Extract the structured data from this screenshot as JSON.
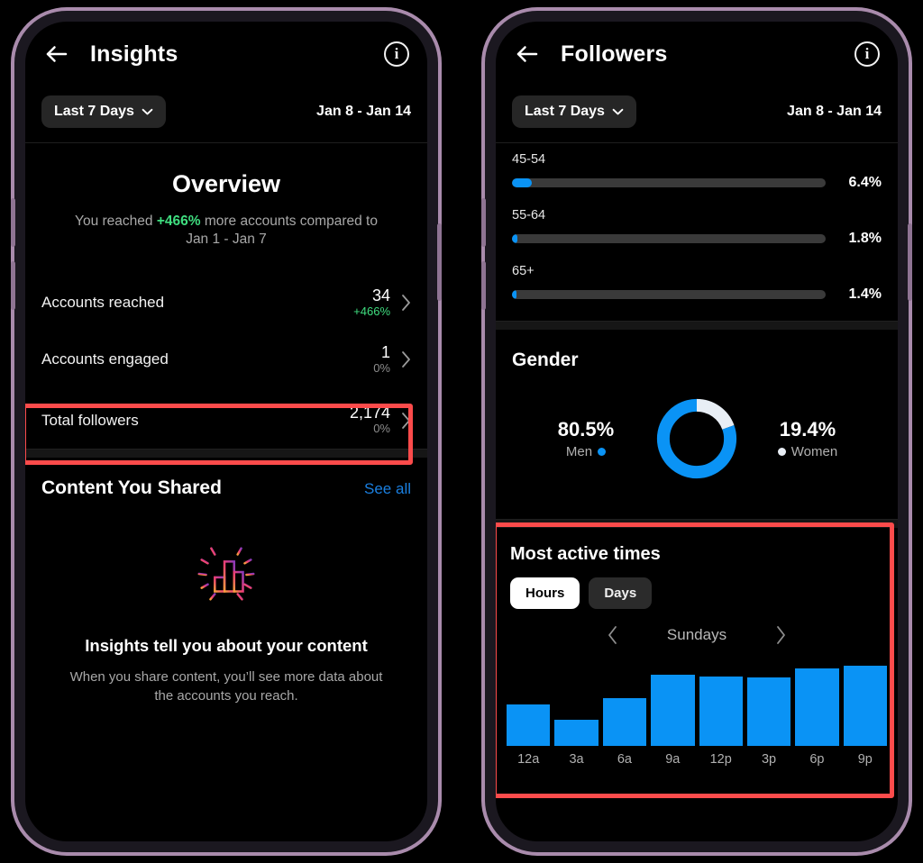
{
  "left_phone": {
    "appbar": {
      "title": "Insights",
      "back_icon": "back-arrow-icon",
      "info_icon": "info-icon"
    },
    "date_filter": {
      "label": "Last 7 Days",
      "caret_icon": "chevron-down-icon",
      "range": "Jan 8 - Jan 14"
    },
    "overview": {
      "title": "Overview",
      "summary_prefix": "You reached ",
      "summary_delta": "+466%",
      "summary_suffix": " more accounts compared to",
      "summary_compare_range": "Jan 1 - Jan 7",
      "stats": [
        {
          "label": "Accounts reached",
          "value": "34",
          "delta": "+466%",
          "delta_kind": "pos",
          "highlighted": false
        },
        {
          "label": "Accounts engaged",
          "value": "1",
          "delta": "0%",
          "delta_kind": "flat",
          "highlighted": false
        },
        {
          "label": "Total followers",
          "value": "2,174",
          "delta": "0%",
          "delta_kind": "flat",
          "highlighted": true
        }
      ]
    },
    "content_shared": {
      "title": "Content You Shared",
      "see_all": "See all",
      "illustration": "bar-chart-sparkle-icon",
      "empty_heading": "Insights tell you about your content",
      "empty_body": "When you share content, you’ll see more data about the accounts you reach."
    }
  },
  "right_phone": {
    "appbar": {
      "title": "Followers",
      "back_icon": "back-arrow-icon",
      "info_icon": "info-icon"
    },
    "date_filter": {
      "label": "Last 7 Days",
      "caret_icon": "chevron-down-icon",
      "range": "Jan 8 - Jan 14"
    },
    "age_ranges": [
      {
        "label": "45-54",
        "pct": "6.4%",
        "fill": 6.4
      },
      {
        "label": "55-64",
        "pct": "1.8%",
        "fill": 1.8
      },
      {
        "label": "65+",
        "pct": "1.4%",
        "fill": 1.4
      }
    ],
    "gender": {
      "title": "Gender",
      "men_pct": "80.5%",
      "men_label": "Men",
      "men_color": "#0a93f5",
      "women_pct": "19.4%",
      "women_label": "Women",
      "women_color": "#e8eef5"
    },
    "most_active": {
      "title": "Most active times",
      "tabs": [
        {
          "label": "Hours",
          "selected": true
        },
        {
          "label": "Days",
          "selected": false
        }
      ],
      "prev_icon": "chevron-left-icon",
      "next_icon": "chevron-right-icon",
      "day": "Sundays"
    }
  },
  "chart_data": [
    {
      "type": "bar",
      "title": "Age ranges (Followers)",
      "categories": [
        "45-54",
        "55-64",
        "65+"
      ],
      "values": [
        6.4,
        1.8,
        1.4
      ],
      "value_labels": [
        "6.4%",
        "1.8%",
        "1.4%"
      ],
      "orientation": "horizontal",
      "xlabel": "",
      "ylabel": "",
      "xlim": [
        0,
        100
      ],
      "grid": false,
      "legend": false,
      "bar_color": "#0a93f5",
      "track_color": "#3a3a3a"
    },
    {
      "type": "pie",
      "title": "Gender",
      "variant": "donut",
      "categories": [
        "Women",
        "Men"
      ],
      "values": [
        19.4,
        80.5
      ],
      "value_labels": [
        "19.4%",
        "80.5%"
      ],
      "colors": [
        "#e8eef5",
        "#0a93f5"
      ],
      "start_angle_deg": 0,
      "direction": "clockwise",
      "legend": true,
      "legend_position": "sides"
    },
    {
      "type": "bar",
      "title": "Most active times — Sundays (Hours)",
      "categories": [
        "12a",
        "3a",
        "6a",
        "9a",
        "12p",
        "3p",
        "6p",
        "9p"
      ],
      "values": [
        48,
        30,
        55,
        82,
        80,
        79,
        90,
        93
      ],
      "xlabel": "",
      "ylabel": "",
      "ylim": [
        0,
        100
      ],
      "grid": false,
      "legend": false,
      "bar_color": "#0a93f5"
    }
  ]
}
